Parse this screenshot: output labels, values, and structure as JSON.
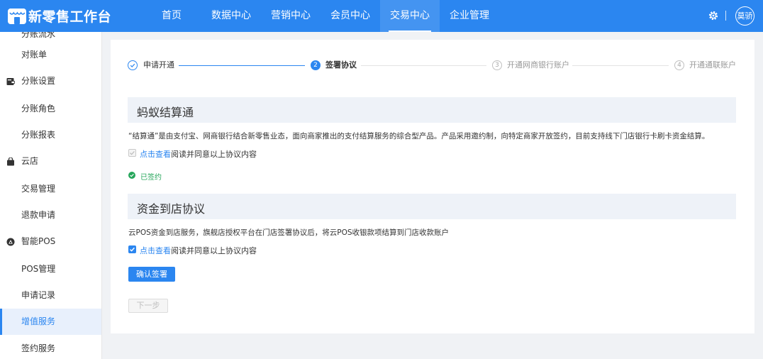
{
  "header": {
    "brand": "新零售工作台",
    "nav": [
      "首页",
      "数据中心",
      "营销中心",
      "会员中心",
      "交易中心",
      "企业管理"
    ],
    "active_nav": "交易中心",
    "avatar_text": "莫骄",
    "brand_color": "#2b86f0"
  },
  "sidebar": {
    "cut_item": "分账流水",
    "items": [
      {
        "label": "对账单",
        "kind": "sub"
      },
      {
        "label": "分账设置",
        "kind": "group",
        "icon": "wallet-icon"
      },
      {
        "label": "分账角色",
        "kind": "sub"
      },
      {
        "label": "分账报表",
        "kind": "sub"
      },
      {
        "label": "云店",
        "kind": "group",
        "icon": "shopping-bag-icon"
      },
      {
        "label": "交易管理",
        "kind": "sub"
      },
      {
        "label": "退款申请",
        "kind": "sub"
      },
      {
        "label": "智能POS",
        "kind": "group",
        "icon": "pos-icon"
      },
      {
        "label": "POS管理",
        "kind": "sub"
      },
      {
        "label": "申请记录",
        "kind": "sub"
      },
      {
        "label": "增值服务",
        "kind": "sub",
        "active": true
      },
      {
        "label": "签约服务",
        "kind": "sub"
      }
    ]
  },
  "steps": [
    {
      "label": "申请开通",
      "state": "done",
      "number": ""
    },
    {
      "label": "签署协议",
      "state": "current",
      "number": "2"
    },
    {
      "label": "开通网商银行账户",
      "state": "pending",
      "number": "3"
    },
    {
      "label": "开通通联账户",
      "state": "pending",
      "number": "4"
    }
  ],
  "section1": {
    "title": "蚂蚁结算通",
    "description": "“结算通”是由支付宝、网商银行结合新零售业态，面向商家推出的支付结算服务的综合型产品。产品采用邀约制，向特定商家开放签约，目前支持线下门店银行卡刷卡资金结算。",
    "link_text": "点击查看",
    "agree_text": "阅读并同意以上协议内容",
    "checkbox_state": "disabled-checked",
    "status_text": "已签约"
  },
  "section2": {
    "title": "资金到店协议",
    "description": "云POS资金到店服务，旗舰店授权平台在门店签署协议后，将云POS收银款项结算到门店收款账户",
    "link_text": "点击查看",
    "agree_text": "阅读并同意以上协议内容",
    "checkbox_state": "checked"
  },
  "buttons": {
    "confirm": "确认签署",
    "next": "下一步"
  }
}
